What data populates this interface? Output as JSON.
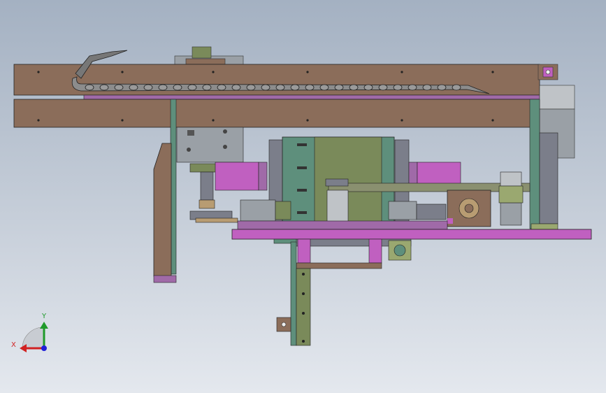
{
  "viewport": {
    "background_top": "#a4b1c2",
    "background_bottom": "#e4e8ee"
  },
  "triad": {
    "x_label": "X",
    "y_label": "Y",
    "x_color": "#d12121",
    "y_color": "#1f9a2a",
    "z_color": "#2020d8"
  },
  "colors": {
    "wood": "#8b6d5a",
    "purple": "#a06aa8",
    "magenta": "#c060c0",
    "teal": "#5e8f7c",
    "olive": "#7a8a5a",
    "gray": "#9aa0a6",
    "tan": "#b89c72"
  }
}
